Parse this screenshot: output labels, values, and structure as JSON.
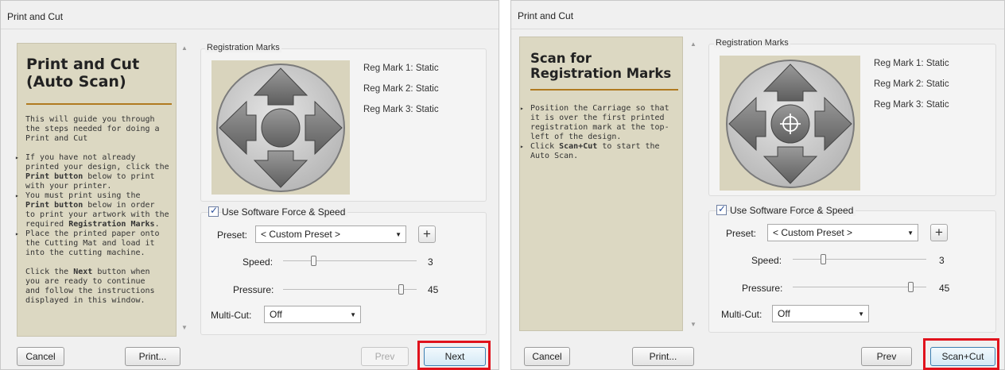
{
  "left": {
    "title": "Print and Cut",
    "panel": {
      "heading_line1": "Print and Cut",
      "heading_line2": "(Auto Scan)",
      "intro_lines": [
        "This will guide you through",
        "the steps needed for doing a",
        "Print and Cut"
      ],
      "bullet1_lines": [
        "If you have not already",
        "printed your design, click the"
      ],
      "bullet1_bold": "Print button",
      "bullet1_after": " below to print",
      "bullet1_last": "with your printer.",
      "bullet2_line1": "You must print using the",
      "bullet2_bold": "Print button",
      "bullet2_after": " below in order",
      "bullet2_lines": [
        "to print your artwork with the"
      ],
      "bullet2_pre": "required ",
      "bullet2_bold2": "Registration Marks",
      "bullet2_end": ".",
      "bullet3_lines": [
        "Place the printed paper onto",
        "the Cutting Mat and load it",
        "into the cutting machine."
      ],
      "outro_pre": "Click the ",
      "outro_bold": "Next",
      "outro_after": " button when",
      "outro_lines": [
        "you are ready to continue",
        "and follow the instructions",
        "displayed in this window."
      ]
    },
    "registration": {
      "group_label": "Registration Marks",
      "marks": [
        "Reg Mark 1:  Static",
        "Reg Mark 2:  Static",
        "Reg Mark 3:  Static"
      ]
    },
    "settings": {
      "checkbox_label": "Use Software Force  & Speed",
      "preset_label": "Preset:",
      "preset_value": "< Custom Preset >",
      "plus": "+",
      "speed_label": "Speed:",
      "speed_value": "3",
      "speed_level": 0.22,
      "pressure_label": "Pressure:",
      "pressure_value": "45",
      "pressure_level": 0.9,
      "multicut_label": "Multi-Cut:",
      "multicut_value": "Off"
    },
    "buttons": {
      "cancel": "Cancel",
      "print": "Print...",
      "prev": "Prev",
      "next": "Next"
    }
  },
  "right": {
    "title": "Print and Cut",
    "panel": {
      "heading_line1": "Scan for",
      "heading_line2": "Registration Marks",
      "bullet1_lines": [
        "Position the Carriage so that",
        "it is over the first printed",
        "registration mark at the top-",
        "left of the design."
      ],
      "bullet2_pre": "Click ",
      "bullet2_bold": "Scan+Cut",
      "bullet2_after": " to start the",
      "bullet2_last": "Auto Scan."
    },
    "registration": {
      "group_label": "Registration Marks",
      "marks": [
        "Reg Mark 1:  Static",
        "Reg Mark 2:  Static",
        "Reg Mark 3:  Static"
      ]
    },
    "settings": {
      "checkbox_label": "Use Software Force  & Speed",
      "preset_label": "Preset:",
      "preset_value": "< Custom Preset >",
      "plus": "+",
      "speed_label": "Speed:",
      "speed_value": "3",
      "speed_level": 0.22,
      "pressure_label": "Pressure:",
      "pressure_value": "45",
      "pressure_level": 0.9,
      "multicut_label": "Multi-Cut:",
      "multicut_value": "Off"
    },
    "buttons": {
      "cancel": "Cancel",
      "print": "Print...",
      "prev": "Prev",
      "scan_cut": "Scan+Cut"
    }
  },
  "colors": {
    "highlight": "#e0121c",
    "panel": "#dcd8c2",
    "rule": "#b07a20"
  }
}
